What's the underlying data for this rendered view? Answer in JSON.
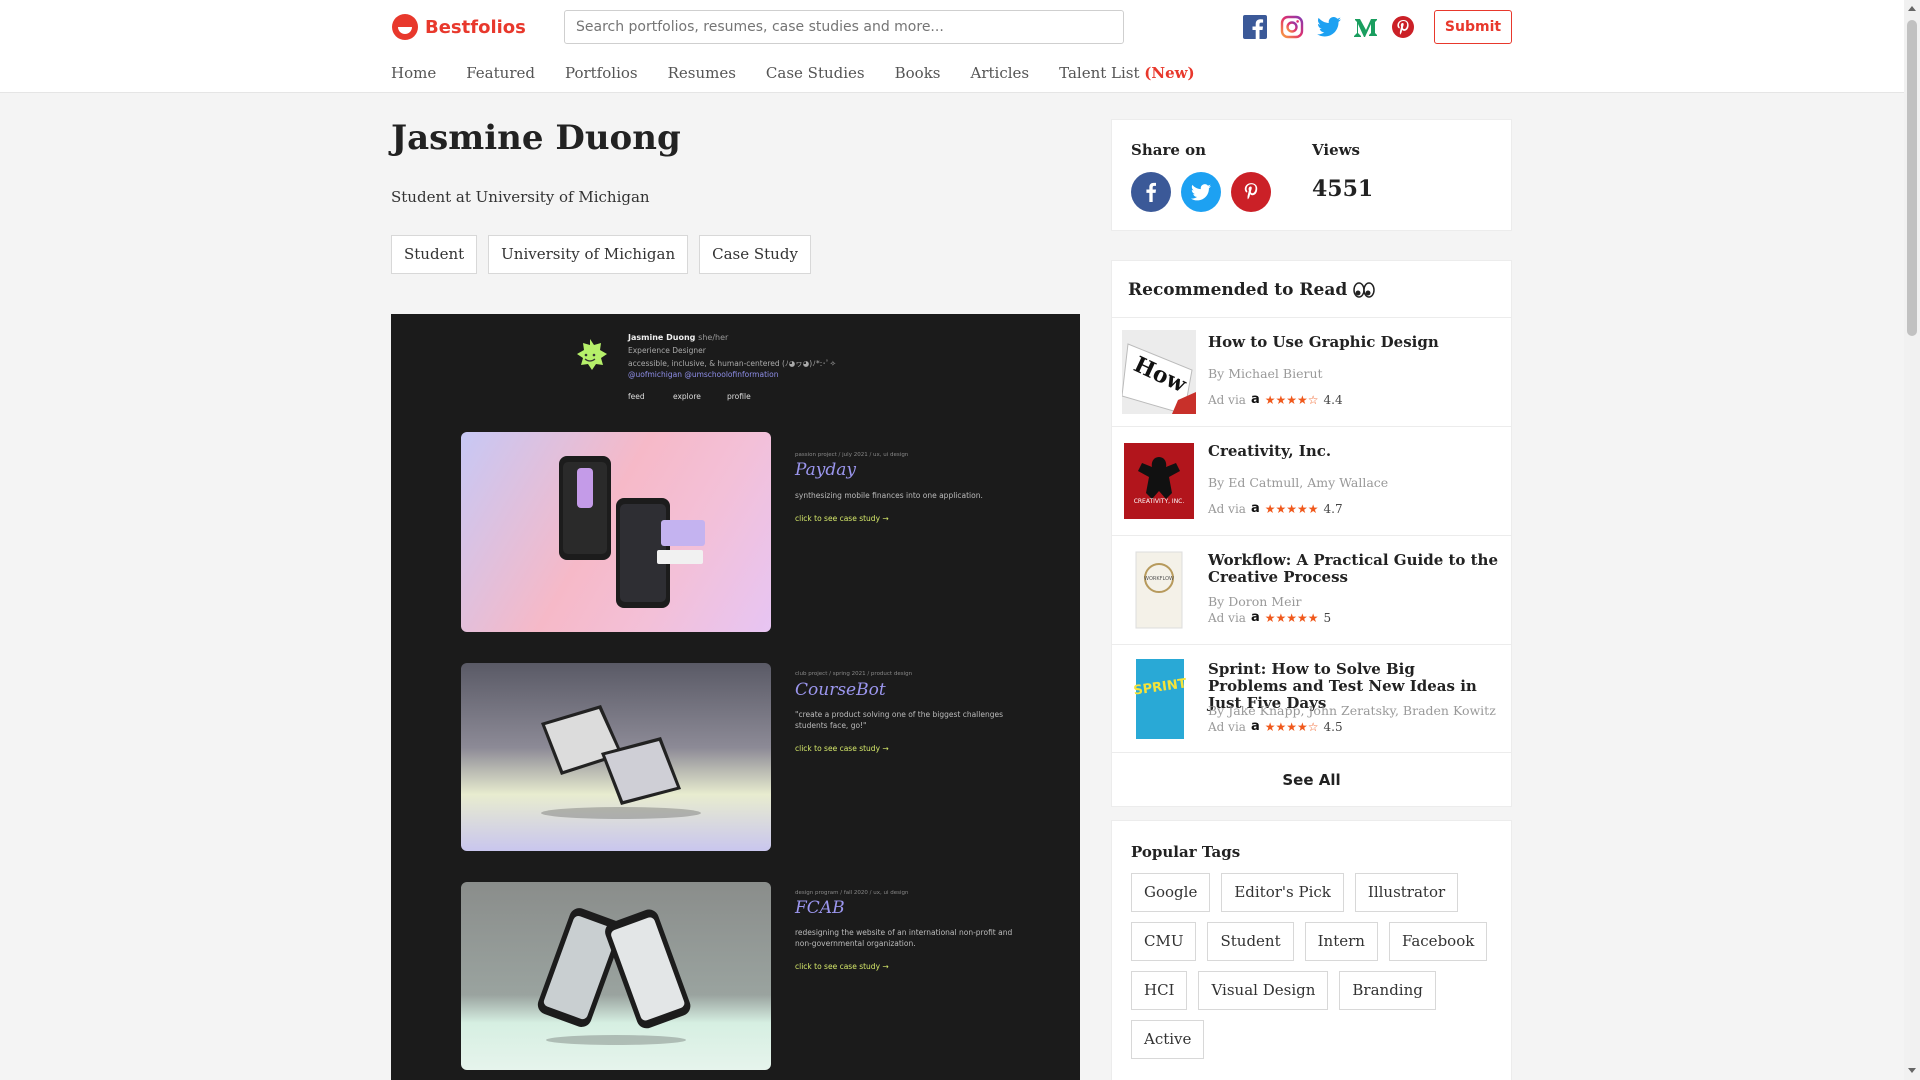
{
  "header": {
    "logo_text": "Bestfolios",
    "search_placeholder": "Search portfolios, resumes, case studies and more...",
    "socials": [
      "facebook-icon",
      "instagram-icon",
      "twitter-icon",
      "medium-icon",
      "pinterest-icon"
    ],
    "submit_label": "Submit"
  },
  "nav": {
    "items": [
      "Home",
      "Featured",
      "Portfolios",
      "Resumes",
      "Case Studies",
      "Books",
      "Articles",
      "Talent List"
    ],
    "new_badge": "(New)"
  },
  "profile": {
    "name": "Jasmine Duong",
    "subtitle": "Student at University of Michigan",
    "tags": [
      "Student",
      "University of Michigan",
      "Case Study"
    ]
  },
  "preview": {
    "name": "Jasmine Duong",
    "pronoun": "she/her",
    "role": "Experience Designer",
    "tagline": "accessible, inclusive, & human-centered (ﾉ◕ヮ◕)ﾉ*:･ﾟ✧",
    "links": "@uofmichigan @umschoolofinformation",
    "nav": [
      "feed",
      "explore",
      "profile"
    ],
    "projects": [
      {
        "meta": "passion project / july 2021 / ux, ui design",
        "name": "Payday",
        "desc": "synthesizing mobile finances into one application.",
        "cta": "click to see case study →"
      },
      {
        "meta": "club project / spring 2021 / product design",
        "name": "CourseBot",
        "desc": "\"create a product solving one of the biggest challenges students face, go!\"",
        "cta": "click to see case study →"
      },
      {
        "meta": "design program / fall 2020 / ux, ui design",
        "name": "FCAB",
        "desc": "redesigning the website of an international non-profit and non-governmental organization.",
        "cta": "click to see case study →"
      }
    ]
  },
  "share": {
    "label": "Share on",
    "views_label": "Views",
    "views_count": "4551"
  },
  "recommended": {
    "title": "Recommended to Read",
    "ad_via": "Ad via",
    "amazon_mark": "a",
    "books": [
      {
        "title": "How to Use Graphic Design",
        "author": "By Michael Bierut",
        "stars": "★★★★☆",
        "rating": "4.4"
      },
      {
        "title": "Creativity, Inc.",
        "author": "By Ed Catmull, Amy Wallace",
        "stars": "★★★★★",
        "rating": "4.7"
      },
      {
        "title": "Workflow: A Practical Guide to the Creative Process",
        "author": "By Doron Meir",
        "stars": "★★★★★",
        "rating": "5"
      },
      {
        "title": "Sprint: How to Solve Big Problems and Test New Ideas in Just Five Days",
        "author": "By Jake Knapp, John Zeratsky, Braden Kowitz",
        "stars": "★★★★☆",
        "rating": "4.5"
      }
    ],
    "see_all": "See All"
  },
  "popular_tags": {
    "title": "Popular Tags",
    "tags": [
      "Google",
      "Editor's Pick",
      "Illustrator",
      "CMU",
      "Student",
      "Intern",
      "Facebook",
      "HCI",
      "Visual Design",
      "Branding",
      "Active"
    ]
  },
  "colors": {
    "brand": "#e8382c",
    "facebook": "#3b5998",
    "twitter": "#1da1f2",
    "pinterest": "#cb2027",
    "star": "#f0591c"
  }
}
